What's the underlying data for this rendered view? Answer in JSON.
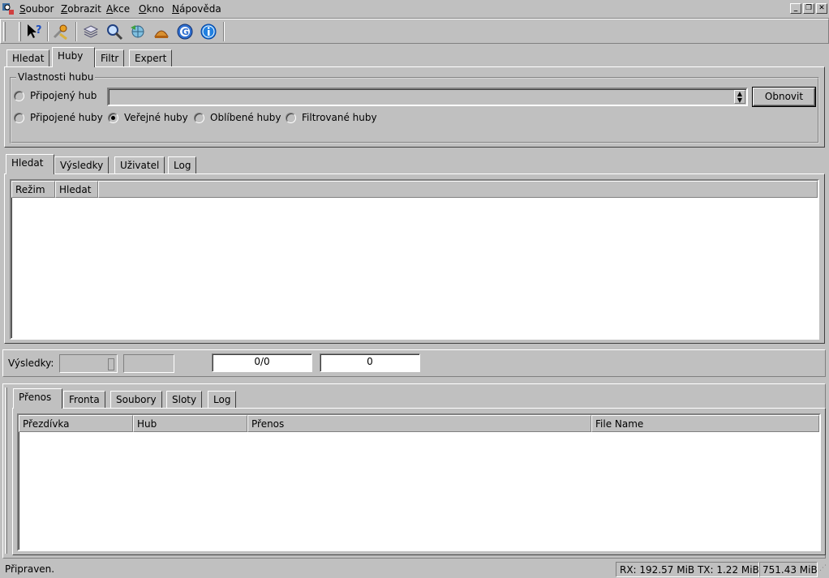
{
  "menu": {
    "items": [
      {
        "label": "Soubor",
        "accel": "S",
        "rest": "oubor"
      },
      {
        "label": "Zobrazit",
        "accel": "Z",
        "rest": "obrazit"
      },
      {
        "label": "Akce",
        "accel": "A",
        "rest": "kce"
      },
      {
        "label": "Okno",
        "accel": "O",
        "rest": "kno"
      },
      {
        "label": "Nápověda",
        "accel": "N",
        "rest": "ápověda"
      }
    ]
  },
  "window_buttons": {
    "minimize": "_",
    "restore": "❐",
    "close": "✕"
  },
  "toolbar": {
    "icons": [
      "whats-this-icon",
      "settings-wrench-icon",
      "layers-icon",
      "search-magnifier-icon",
      "globe-transfer-icon",
      "cake-icon",
      "g-circle-icon",
      "info-icon"
    ]
  },
  "top_tabs": [
    "Hledat",
    "Huby",
    "Filtr",
    "Expert"
  ],
  "top_tabs_active": 1,
  "hub_properties": {
    "group_title": "Vlastnosti hubu",
    "connected_hub_label": "Připojený hub",
    "combo_value": "",
    "refresh_label": "Obnovit",
    "radios": [
      {
        "label": "Připojené huby",
        "checked": false
      },
      {
        "label": "Veřejné huby",
        "checked": true
      },
      {
        "label": "Oblíbené huby",
        "checked": false
      },
      {
        "label": "Filtrované huby",
        "checked": false
      }
    ]
  },
  "middle_tabs": [
    "Hledat",
    "Výsledky",
    "Uživatel",
    "Log"
  ],
  "middle_tabs_active": 0,
  "search_table": {
    "columns": [
      "Režim",
      "Hledat",
      ""
    ]
  },
  "results_bar": {
    "label": "Výsledky:",
    "count_value": "",
    "field2": "",
    "ratio": "0/0",
    "count": "0"
  },
  "bottom_tabs": [
    "Přenos",
    "Fronta",
    "Soubory",
    "Sloty",
    "Log"
  ],
  "bottom_tabs_active": 0,
  "transfer_table": {
    "columns": [
      "Přezdívka",
      "Hub",
      "Přenos",
      "File Name"
    ]
  },
  "status": {
    "text": "Připraven.",
    "rxtx": "RX: 192.57 MiB TX: 1.22 MiB",
    "size": "751.43 MiB"
  }
}
